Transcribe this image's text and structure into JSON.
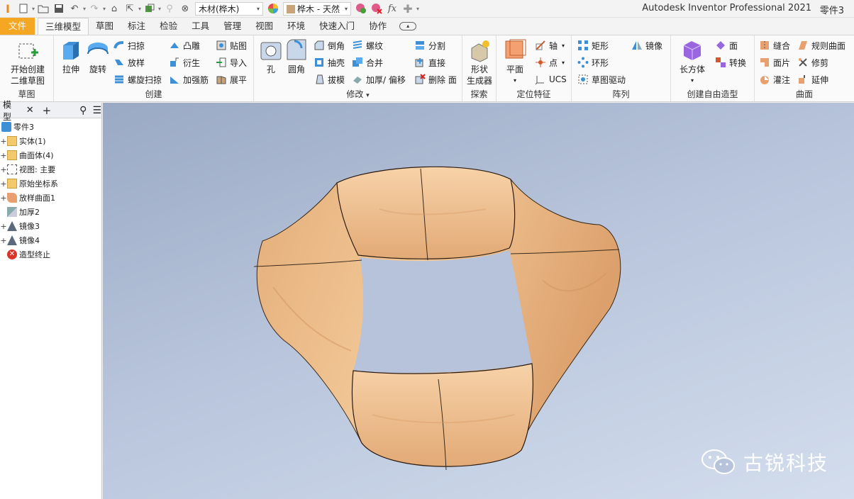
{
  "app": {
    "title": "Autodesk Inventor Professional 2021",
    "part": "零件3"
  },
  "qat": {
    "material": "木材(桦木)",
    "appearance": "桦木 - 天然"
  },
  "tabs": [
    "文件",
    "三维模型",
    "草图",
    "标注",
    "检验",
    "工具",
    "管理",
    "视图",
    "环境",
    "快速入门",
    "协作"
  ],
  "ribbon": {
    "sketch": {
      "label": "草图",
      "start": "开始创建",
      "start2": "二维草图"
    },
    "create": {
      "label": "创建",
      "extrude": "拉伸",
      "revolve": "旋转",
      "sweep": "扫掠",
      "loft": "放样",
      "coil": "螺旋扫掠",
      "emboss": "凸雕",
      "derive": "衍生",
      "rib": "加强筋",
      "decal": "贴图",
      "import": "导入",
      "unfold": "展平"
    },
    "modify": {
      "label": "修改",
      "hole": "孔",
      "fillet": "圆角",
      "chamfer": "倒角",
      "shell": "抽壳",
      "draft": "拔模",
      "thread": "螺纹",
      "combine": "合并",
      "thicken": "加厚/ 偏移",
      "split": "分割",
      "direct": "直接",
      "delete": "删除 面"
    },
    "explore": {
      "label": "探索",
      "shape": "形状",
      "shape2": "生成器"
    },
    "workfeatures": {
      "label": "定位特征",
      "plane": "平面",
      "axis": "轴",
      "point": "点",
      "ucs": "UCS"
    },
    "pattern": {
      "label": "阵列",
      "rect": "矩形",
      "circ": "环形",
      "sketchdriven": "草图驱动",
      "mirror": "镜像"
    },
    "freeform": {
      "label": "创建自由造型",
      "box": "长方体",
      "face": "面",
      "convert": "转换"
    },
    "surface": {
      "label": "曲面",
      "stitch": "缝合",
      "patch": "面片",
      "sculpt": "灌注",
      "ruled": "规则曲面",
      "trim": "修剪",
      "extend": "延伸"
    }
  },
  "browser": {
    "tab": "模型",
    "items": [
      "零件3",
      "实体(1)",
      "曲面体(4)",
      "视图: 主要",
      "原始坐标系",
      "放样曲面1",
      "加厚2",
      "镜像3",
      "镜像4",
      "造型终止"
    ]
  },
  "watermark": "古锐科技",
  "colors": {
    "file_tab": "#f5a623",
    "wood": "#eab989",
    "viewport_top": "#9aa9c4",
    "viewport_bottom": "#d3dded"
  }
}
